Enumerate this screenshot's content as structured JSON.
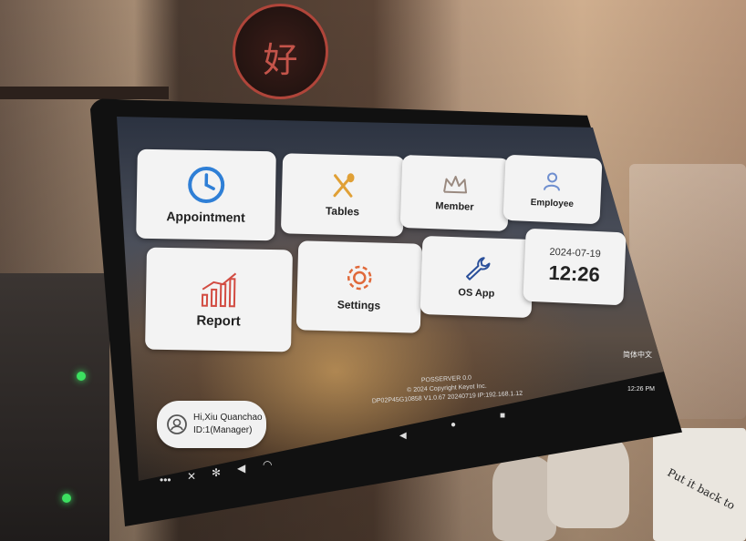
{
  "app": {
    "tiles": [
      {
        "id": "appointment",
        "label": "Appointment",
        "icon": "clock-icon",
        "color": "#2f7fd6"
      },
      {
        "id": "tables",
        "label": "Tables",
        "icon": "fork-spoon-icon",
        "color": "#e0a036"
      },
      {
        "id": "member",
        "label": "Member",
        "icon": "crown-icon",
        "color": "#9a8a80"
      },
      {
        "id": "employee",
        "label": "Employee",
        "icon": "person-id-icon",
        "color": "#6f8fcf"
      },
      {
        "id": "report",
        "label": "Report",
        "icon": "bar-chart-icon",
        "color": "#d24c42"
      },
      {
        "id": "settings",
        "label": "Settings",
        "icon": "gear-icon",
        "color": "#e0693a"
      },
      {
        "id": "os_app",
        "label": "OS App",
        "icon": "wrench-icon",
        "color": "#2a4f9a"
      }
    ],
    "clock": {
      "date": "2024-07-19",
      "time": "12:26"
    },
    "user": {
      "greeting": "Hi,Xiu Quanchao",
      "id_line": "ID:1(Manager)",
      "icon": "user-switch-icon"
    },
    "footer": {
      "line1": "POSSERVER 0.0",
      "line2": "© 2024 Copyright Keyot Inc.",
      "line3": "DP02P45G10858 V1.0.67 20240719  IP:192.168.1.12"
    },
    "language": "简体中文",
    "status_time": "12:26 PM"
  },
  "environment": {
    "sign_glyph": "好",
    "note_text": "Put it back to"
  }
}
